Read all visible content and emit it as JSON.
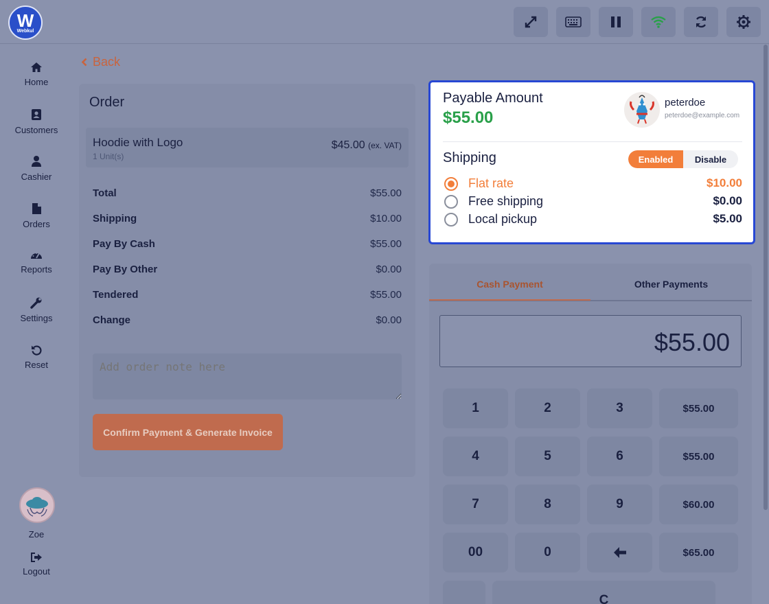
{
  "logo": {
    "letter": "W",
    "text": "Webkul"
  },
  "sidebar": {
    "items": [
      {
        "label": "Home",
        "icon": "home-icon"
      },
      {
        "label": "Customers",
        "icon": "address-book-icon"
      },
      {
        "label": "Cashier",
        "icon": "user-icon"
      },
      {
        "label": "Orders",
        "icon": "file-icon"
      },
      {
        "label": "Reports",
        "icon": "dashboard-icon"
      },
      {
        "label": "Settings",
        "icon": "wrench-icon"
      },
      {
        "label": "Reset",
        "icon": "undo-icon"
      }
    ],
    "user_name": "Zoe",
    "logout_label": "Logout"
  },
  "back_label": "Back",
  "order": {
    "title": "Order",
    "item": {
      "name": "Hoodie with Logo",
      "qty": "1 Unit(s)",
      "price": "$45.00",
      "tax_note": "(ex. VAT)"
    },
    "summary": [
      {
        "label": "Total",
        "value": "$55.00"
      },
      {
        "label": "Shipping",
        "value": "$10.00"
      },
      {
        "label": "Pay By Cash",
        "value": "$55.00"
      },
      {
        "label": "Pay By Other",
        "value": "$0.00"
      },
      {
        "label": "Tendered",
        "value": "$55.00"
      },
      {
        "label": "Change",
        "value": "$0.00"
      }
    ],
    "note_placeholder": "Add order note here",
    "confirm_label": "Confirm Payment & Generate Invoice"
  },
  "payable": {
    "label": "Payable Amount",
    "amount": "$55.00",
    "customer_name": "peterdoe",
    "customer_email": "peterdoe@example.com",
    "shipping_title": "Shipping",
    "toggle_on": "Enabled",
    "toggle_off": "Disable",
    "options": [
      {
        "name": "Flat rate",
        "price": "$10.00",
        "selected": true
      },
      {
        "name": "Free shipping",
        "price": "$0.00",
        "selected": false
      },
      {
        "name": "Local pickup",
        "price": "$5.00",
        "selected": false
      }
    ]
  },
  "payment": {
    "tab_cash": "Cash Payment",
    "tab_other": "Other Payments",
    "amount": "$55.00",
    "keys": [
      "1",
      "2",
      "3",
      "$55.00",
      "4",
      "5",
      "6",
      "$55.00",
      "7",
      "8",
      "9",
      "$60.00",
      "00",
      "0",
      "backspace",
      "$65.00"
    ],
    "key_dot": ".",
    "key_clear": "C"
  },
  "colors": {
    "accent": "#f27e3a",
    "brand": "#2a4fc9",
    "success": "#2aa04a",
    "highlight_border": "#2747d4"
  }
}
